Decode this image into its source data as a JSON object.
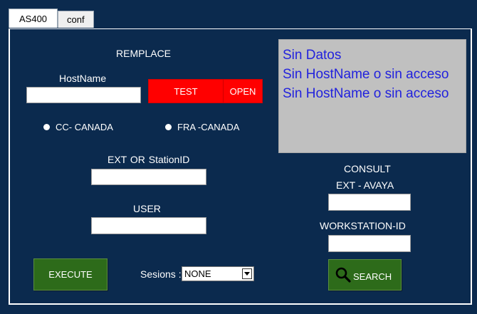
{
  "tabs": [
    {
      "label": "AS400"
    },
    {
      "label": "conf"
    }
  ],
  "remplace": {
    "heading": "REMPLACE",
    "hostname_label": "HostName",
    "hostname_value": "",
    "test_label": "TEST",
    "open_label": "OPEN",
    "radio_options": [
      "CC- CANADA",
      "FRA -CANADA"
    ],
    "ext_label": "EXT  OR  StationID",
    "ext_value": "",
    "user_label": "USER",
    "user_value": "",
    "execute_label": "EXECUTE",
    "sessions_label": "Sesions :",
    "sessions_value": "NONE"
  },
  "info": {
    "lines": [
      "Sin Datos",
      "Sin HostName o sin acceso",
      "Sin HostName o sin acceso"
    ]
  },
  "consult": {
    "heading": "CONSULT",
    "ext_avaya_label": "EXT - AVAYA",
    "ext_avaya_value": "",
    "workstation_label": "WORKSTATION-ID",
    "workstation_value": "",
    "search_label": "SEARCH",
    "search_icon": "magnifier-icon"
  },
  "colors": {
    "background": "#0b2a4e",
    "red_button": "#ff0000",
    "green_button": "#2d6b1a",
    "info_text": "#2222dd",
    "info_background": "#c0c0c0"
  }
}
